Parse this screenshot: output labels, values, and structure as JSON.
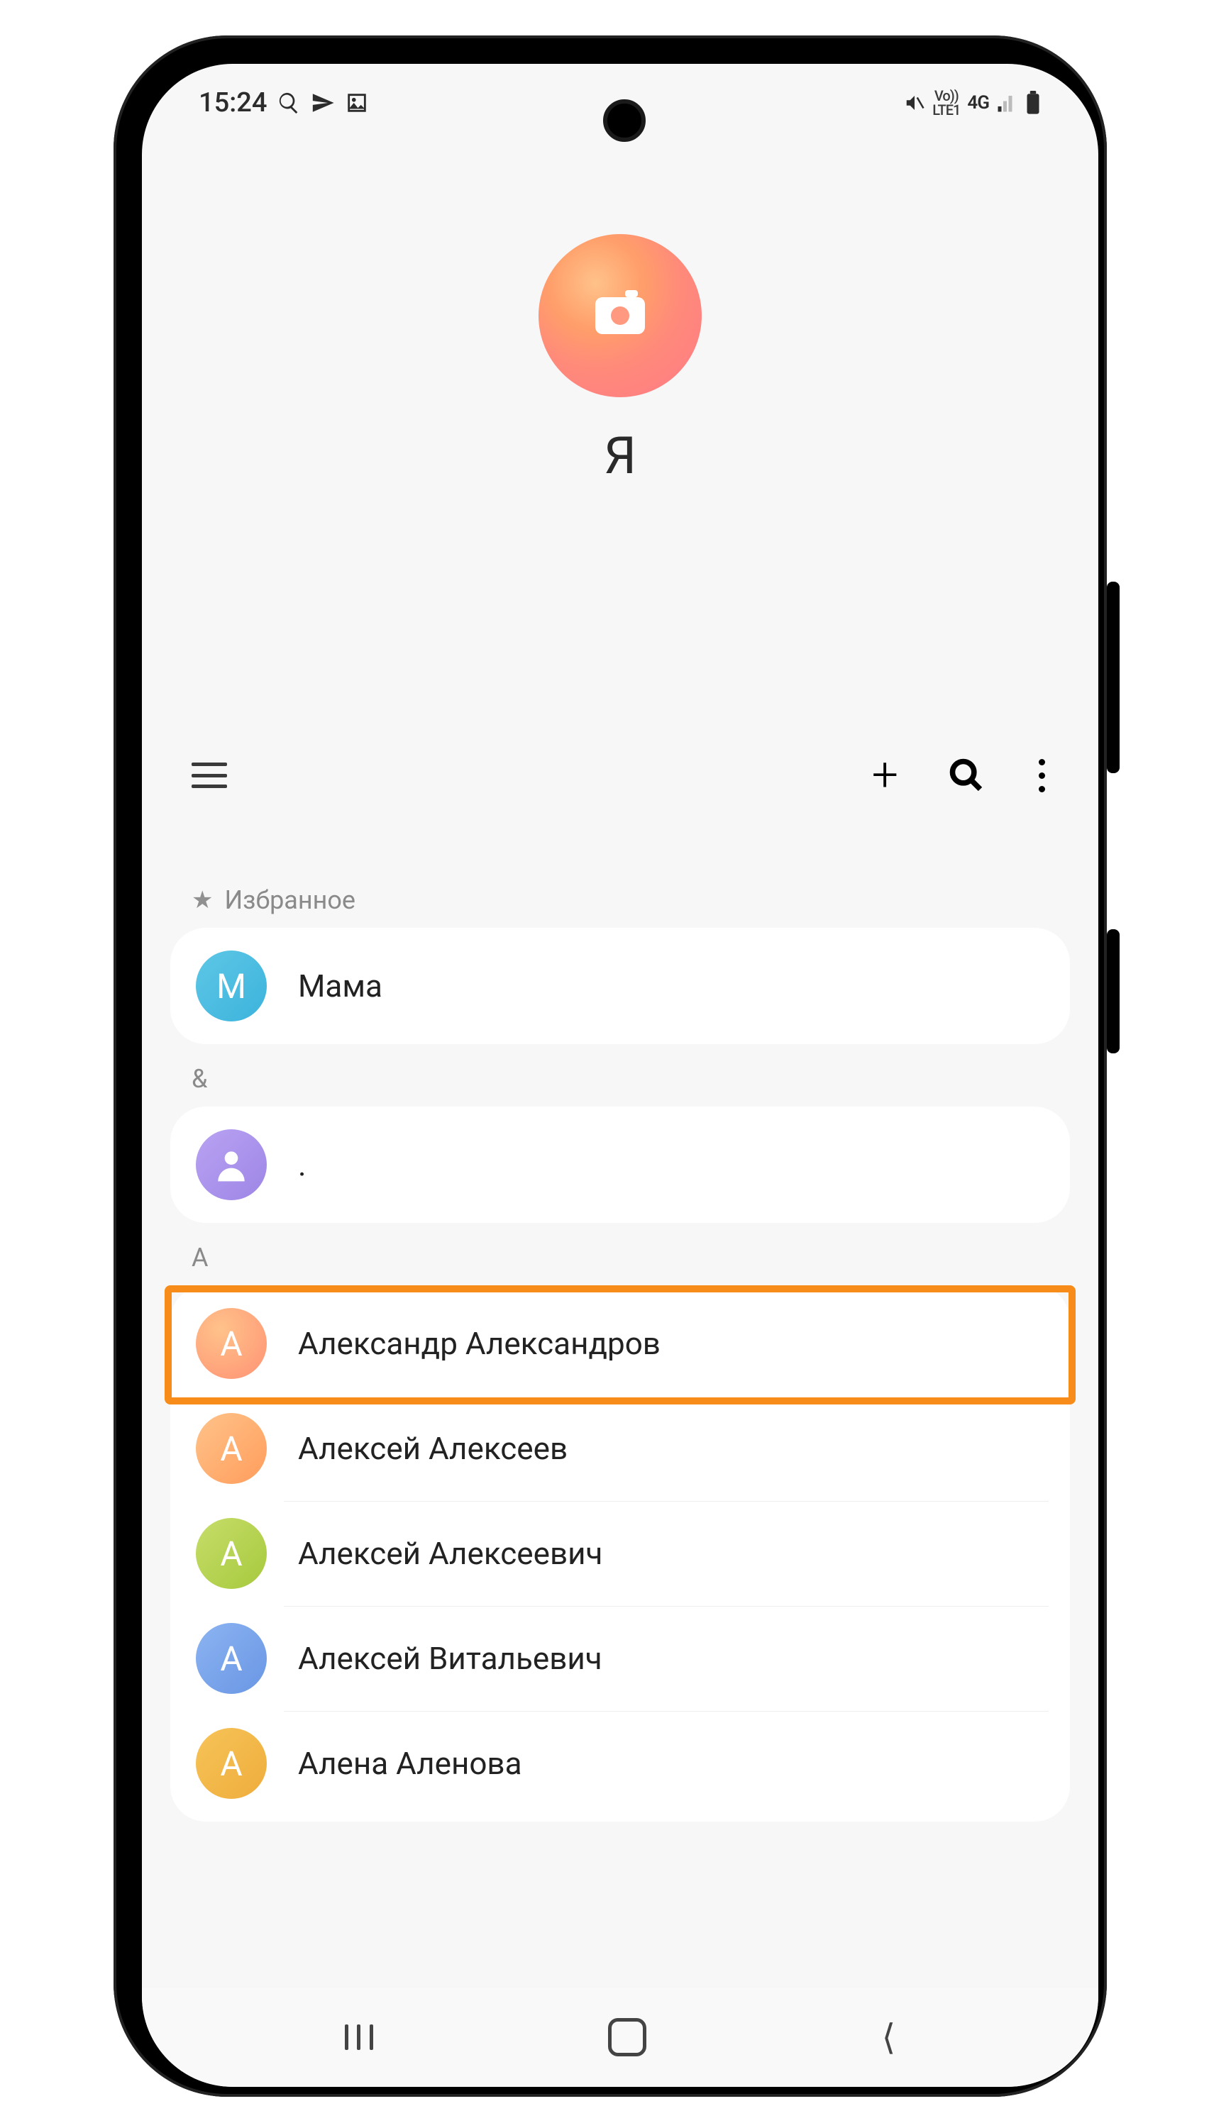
{
  "status_bar": {
    "time": "15:24",
    "icons_left": [
      "magnify",
      "telegram",
      "image"
    ],
    "right": {
      "mute_label": "mute",
      "volte_line1": "Vo))",
      "volte_line2": "LTE1",
      "network": "4G",
      "signal_bars": "signal",
      "battery": "battery"
    }
  },
  "profile": {
    "name": "Я",
    "avatar_icon": "camera"
  },
  "toolbar": {
    "menu": "menu",
    "add": "+",
    "search": "search",
    "more": "more"
  },
  "sections": {
    "favorites": {
      "header": "Избранное",
      "items": [
        {
          "letter": "М",
          "name": "Мама",
          "avatar_class": "av-blue"
        }
      ]
    },
    "amp": {
      "header": "&",
      "items": [
        {
          "letter": "person",
          "name": ".",
          "avatar_class": "av-purple",
          "is_icon": true
        }
      ]
    },
    "a": {
      "header": "A",
      "items": [
        {
          "letter": "А",
          "name": "Александр Александров",
          "avatar_class": "av-orange1",
          "highlighted": true
        },
        {
          "letter": "А",
          "name": "Алексей Алексеев",
          "avatar_class": "av-orange2"
        },
        {
          "letter": "А",
          "name": "Алексей Алексеевич",
          "avatar_class": "av-green"
        },
        {
          "letter": "А",
          "name": "Алексей Витальевич",
          "avatar_class": "av-blue2"
        },
        {
          "letter": "А",
          "name": "Алена Аленова",
          "avatar_class": "av-ochre"
        }
      ]
    }
  },
  "navbar": {
    "recents": "recents",
    "home": "home",
    "back": "back"
  }
}
